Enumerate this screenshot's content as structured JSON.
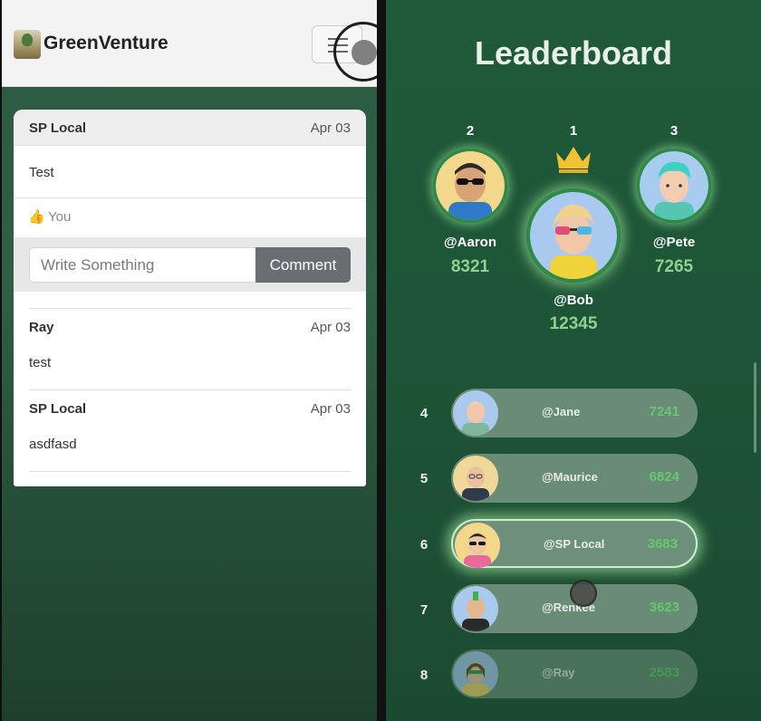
{
  "app": {
    "brand": "GreenVenture"
  },
  "post": {
    "author": "SP Local",
    "date": "Apr 03",
    "text": "Test",
    "likes_icon": "👍",
    "likes_label": "You"
  },
  "comment_form": {
    "placeholder": "Write Something",
    "button": "Comment"
  },
  "replies": [
    {
      "author": "Ray",
      "date": "Apr 03",
      "text": "test"
    },
    {
      "author": "SP Local",
      "date": "Apr 03",
      "text": "asdfasd"
    }
  ],
  "leaderboard": {
    "title": "Leaderboard",
    "podium": [
      {
        "rank": "2",
        "name": "@Aaron",
        "score": "8321"
      },
      {
        "rank": "1",
        "name": "@Bob",
        "score": "12345"
      },
      {
        "rank": "3",
        "name": "@Pete",
        "score": "7265"
      }
    ],
    "rows": [
      {
        "rank": "4",
        "name": "@Jane",
        "score": "7241"
      },
      {
        "rank": "5",
        "name": "@Maurice",
        "score": "6824"
      },
      {
        "rank": "6",
        "name": "@SP Local",
        "score": "3683"
      },
      {
        "rank": "7",
        "name": "@Renkee",
        "score": "3623"
      },
      {
        "rank": "8",
        "name": "@Ray",
        "score": "2583"
      }
    ]
  },
  "colors": {
    "accent_green": "#63c96a",
    "score_green": "#8fd08f",
    "button_gray": "#6a6e72"
  }
}
